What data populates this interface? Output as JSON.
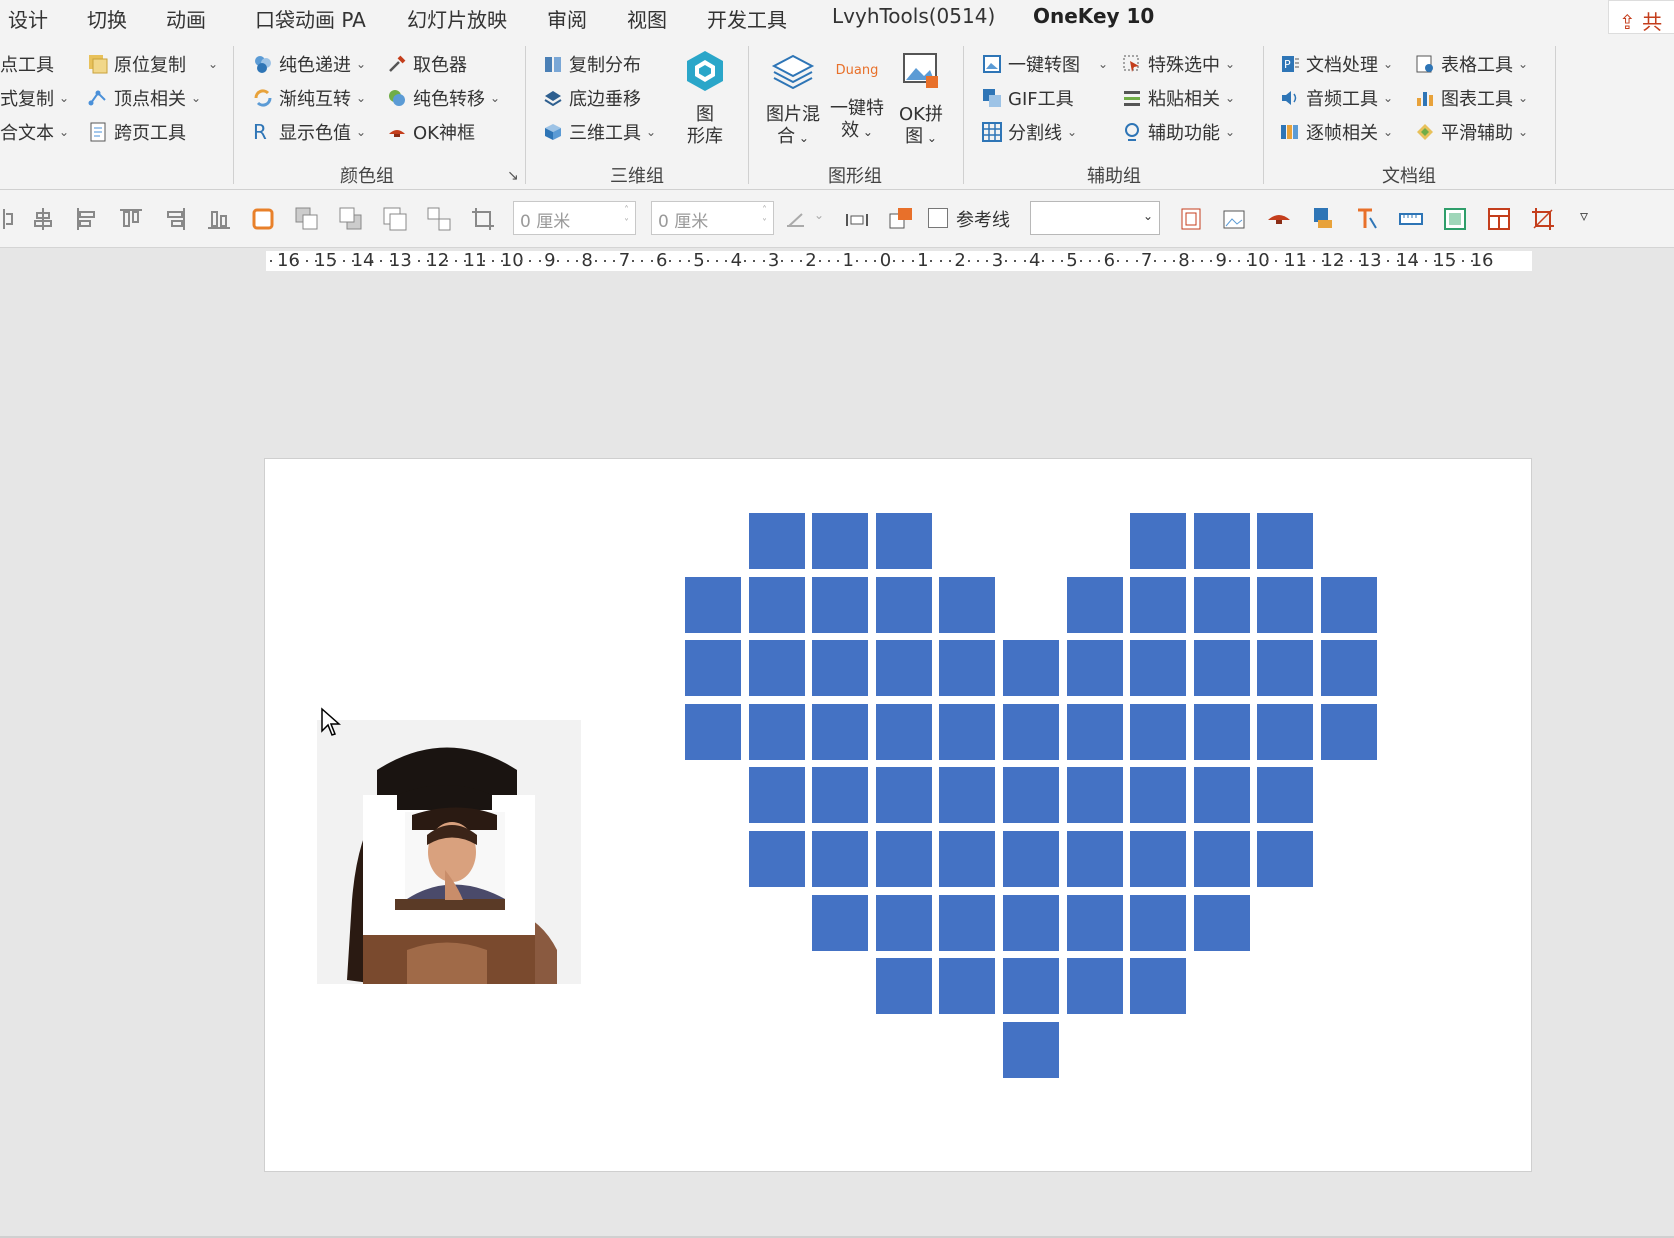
{
  "tabs": [
    "设计",
    "切换",
    "动画",
    "口袋动画 PA",
    "幻灯片放映",
    "审阅",
    "视图",
    "开发工具",
    "LvyhTools(0514)",
    "OneKey 10"
  ],
  "active_tab": "OneKey 10",
  "share_label": "共",
  "ribbon": {
    "partial_group": {
      "col1": [
        "点工具",
        "式复制",
        "合文本"
      ],
      "col2": [
        "原位复制",
        "顶点相关",
        "跨页工具"
      ]
    },
    "color_group": {
      "label": "颜色组",
      "col1": [
        "纯色递进",
        "渐纯互转",
        "显示色值"
      ],
      "col2": [
        "取色器",
        "纯色转移",
        "OK神框"
      ]
    },
    "three_d_group": {
      "label": "三维组",
      "col1": [
        "复制分布",
        "底边垂移",
        "三维工具"
      ],
      "big": [
        "图",
        "形库"
      ]
    },
    "shape_group": {
      "label": "图形组",
      "blend": [
        "图片混",
        "合"
      ],
      "effect": [
        "一键特",
        "效"
      ],
      "effect_icon_text": "Duang",
      "puzzle": [
        "OK拼",
        "图"
      ]
    },
    "assist_group": {
      "label": "辅助组",
      "col1": [
        "一键转图",
        "GIF工具",
        "分割线"
      ],
      "col2": [
        "特殊选中",
        "粘贴相关",
        "辅助功能"
      ]
    },
    "doc_group": {
      "label": "文档组",
      "col1": [
        "文档处理",
        "音频工具",
        "逐帧相关"
      ],
      "col2": [
        "表格工具",
        "图表工具",
        "平滑辅助"
      ]
    }
  },
  "toolbar": {
    "width_value": "0 厘米",
    "height_value": "0 厘米",
    "guide_label": "参考线",
    "combo_value": ""
  },
  "ruler_labels": [
    "16",
    "15",
    "14",
    "13",
    "12",
    "11",
    "10",
    "9",
    "8",
    "7",
    "6",
    "5",
    "4",
    "3",
    "2",
    "1",
    "0",
    "1",
    "2",
    "3",
    "4",
    "5",
    "6",
    "7",
    "8",
    "9",
    "10",
    "11",
    "12",
    "13",
    "14",
    "15",
    "16"
  ],
  "heart": {
    "color": "#4472c4",
    "rows": [
      [
        1,
        2,
        3,
        7,
        8,
        9
      ],
      [
        0,
        1,
        2,
        3,
        4,
        6,
        7,
        8,
        9,
        10
      ],
      [
        0,
        1,
        2,
        3,
        4,
        5,
        6,
        7,
        8,
        9,
        10
      ],
      [
        0,
        1,
        2,
        3,
        4,
        5,
        6,
        7,
        8,
        9,
        10
      ],
      [
        1,
        2,
        3,
        4,
        5,
        6,
        7,
        8,
        9
      ],
      [
        1,
        2,
        3,
        4,
        5,
        6,
        7,
        8,
        9
      ],
      [
        2,
        3,
        4,
        5,
        6,
        7,
        8
      ],
      [
        3,
        4,
        5,
        6,
        7
      ],
      [
        5
      ]
    ]
  },
  "colors": {
    "accent": "#c43e1c",
    "shape_fill": "#4472c4",
    "ribbon_bg": "#f3f3f3"
  }
}
